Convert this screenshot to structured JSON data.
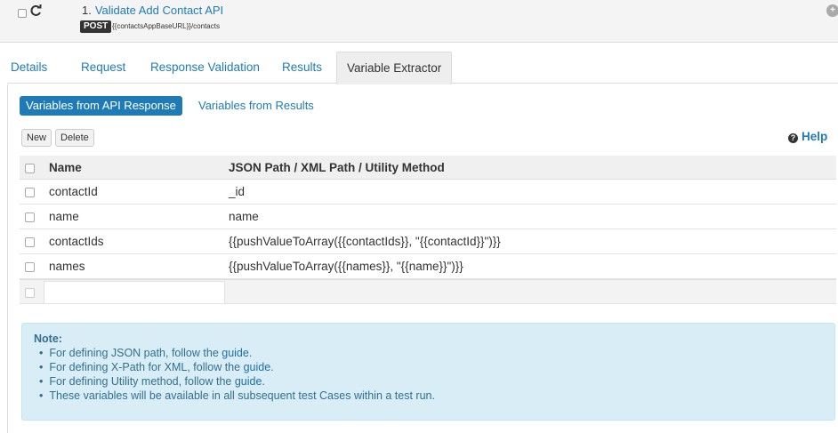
{
  "header": {
    "number": "1.",
    "title": "Validate Add Contact API",
    "method": "POST",
    "endpoint": "{{contactsAppBaseURL}}/contacts"
  },
  "tabs": [
    {
      "label": "Details"
    },
    {
      "label": "Request"
    },
    {
      "label": "Response Validation"
    },
    {
      "label": "Results"
    },
    {
      "label": "Variable Extractor"
    }
  ],
  "subtabs": {
    "active": "Variables from API Response",
    "other": "Variables from Results"
  },
  "buttons": {
    "new": "New",
    "delete": "Delete",
    "help": "Help"
  },
  "table": {
    "headers": [
      "Name",
      "JSON Path / XML Path / Utility Method"
    ],
    "rows": [
      {
        "name": "contactId",
        "path": "_id"
      },
      {
        "name": "name",
        "path": "name"
      },
      {
        "name": "contactIds",
        "path": "{{pushValueToArray({{contactIds}}, \"{{contactId}}\")}}"
      },
      {
        "name": "names",
        "path": "{{pushValueToArray({{names}}, \"{{name}}\")}}"
      }
    ]
  },
  "note": {
    "title": "Note:",
    "items": [
      {
        "text": "For defining JSON path, follow the ",
        "link": "guide",
        "end": "."
      },
      {
        "text": "For defining X-Path for XML, follow the ",
        "link": "guide",
        "end": "."
      },
      {
        "text": "For defining Utility method, follow the ",
        "link": "guide",
        "end": "."
      },
      {
        "text": "These variables will be available in all subsequent test Cases within a test run.",
        "link": "",
        "end": ""
      }
    ]
  },
  "colors": {
    "accent": "#1f7bb6",
    "note_bg": "#d9edf7",
    "note_text": "#31708f"
  }
}
